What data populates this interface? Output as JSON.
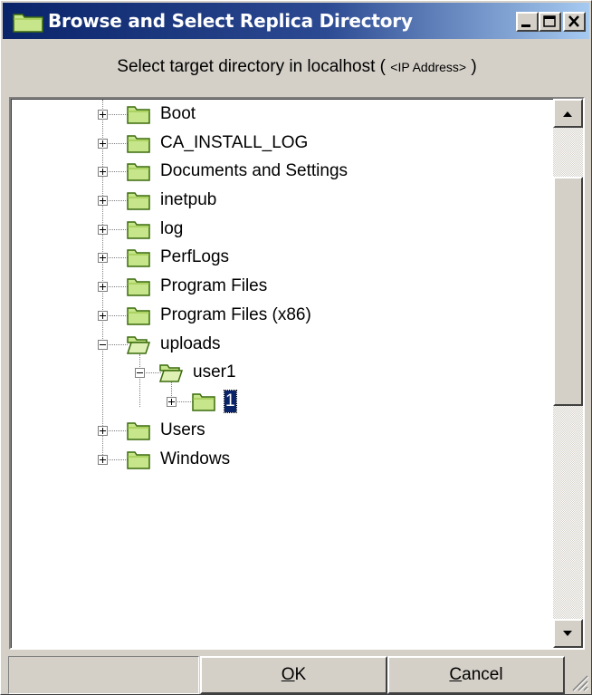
{
  "window": {
    "title": "Browse and Select Replica Directory",
    "title_gradient": [
      "#0a246a",
      "#a6caf0"
    ],
    "controls": [
      "minimize-icon",
      "maximize-icon",
      "close-icon"
    ]
  },
  "subtitle": {
    "prefix": "Select target directory in localhost (",
    "ip": "<IP Address>",
    "suffix": ")"
  },
  "tree": {
    "nodes": [
      {
        "label": "Boot",
        "expander": "plus",
        "open": false
      },
      {
        "label": "CA_INSTALL_LOG",
        "expander": "plus",
        "open": false
      },
      {
        "label": "Documents and Settings",
        "expander": "plus",
        "open": false
      },
      {
        "label": "inetpub",
        "expander": "plus",
        "open": false
      },
      {
        "label": "log",
        "expander": "plus",
        "open": false
      },
      {
        "label": "PerfLogs",
        "expander": "plus",
        "open": false
      },
      {
        "label": "Program Files",
        "expander": "plus",
        "open": false
      },
      {
        "label": "Program Files (x86)",
        "expander": "plus",
        "open": false
      },
      {
        "label": "uploads",
        "expander": "minus",
        "open": true
      },
      {
        "label": "user1",
        "expander": "minus",
        "open": true
      },
      {
        "label": "1",
        "expander": "plus",
        "open": false,
        "selected": true
      },
      {
        "label": "Users",
        "expander": "plus",
        "open": false
      },
      {
        "label": "Windows",
        "expander": "plus",
        "open": false
      }
    ],
    "selection_color": "#0a246a"
  },
  "buttons": {
    "ok": {
      "mnemonic": "O",
      "rest": "K"
    },
    "cancel": {
      "mnemonic": "C",
      "rest": "ancel"
    }
  },
  "colors": {
    "folder_fill": "#c7e58a",
    "folder_stroke": "#3a6b0c",
    "dialog_bg": "#d4d0c8"
  }
}
